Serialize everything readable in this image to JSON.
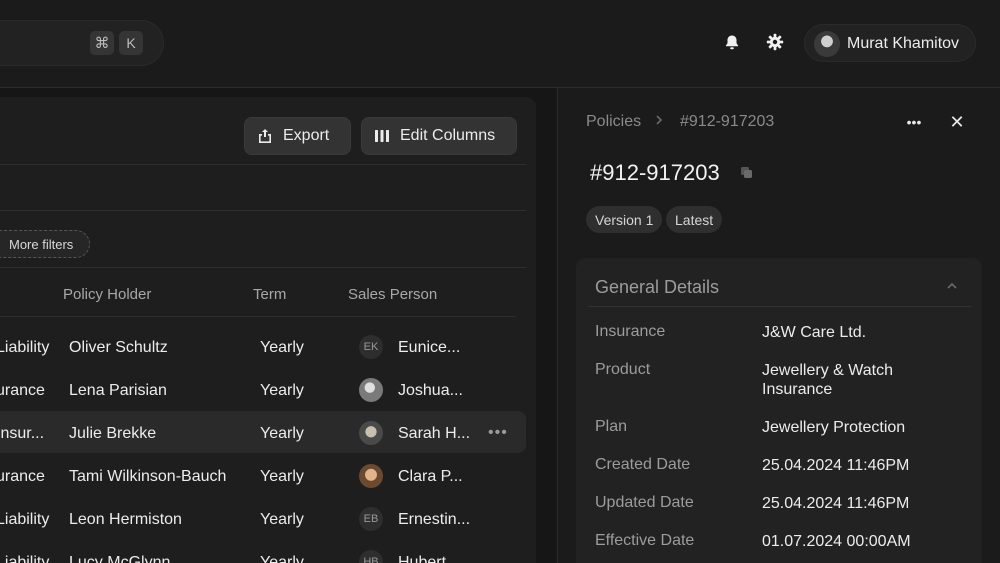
{
  "topbar": {
    "shortcut_keys": [
      "⌘",
      "K"
    ],
    "notification_icon": "bell-icon",
    "settings_icon": "gear-icon",
    "user_name": "Murat Khamitov"
  },
  "toolbar": {
    "export_label": "Export",
    "edit_columns_label": "Edit Columns"
  },
  "filters": {
    "more_filters_label": "More filters"
  },
  "table": {
    "headers": [
      "Policy Holder",
      "Term",
      "Sales Person"
    ],
    "rows": [
      {
        "product": "Liability",
        "holder": "Oliver Schultz",
        "term": "Yearly",
        "avatar": "EK",
        "sales": "Eunice..."
      },
      {
        "product": "urance",
        "holder": "Lena Parisian",
        "term": "Yearly",
        "avatar": "",
        "sales": "Joshua..."
      },
      {
        "product": "Insur...",
        "holder": "Julie Brekke",
        "term": "Yearly",
        "avatar": "",
        "sales": "Sarah H..."
      },
      {
        "product": "urance",
        "holder": "Tami Wilkinson-Bauch",
        "term": "Yearly",
        "avatar": "",
        "sales": "Clara P..."
      },
      {
        "product": "Liability",
        "holder": "Leon Hermiston",
        "term": "Yearly",
        "avatar": "EB",
        "sales": "Ernestin..."
      },
      {
        "product": "Liability",
        "holder": "Lucy McGlynn",
        "term": "Yearly",
        "avatar": "HB",
        "sales": "Hubert..."
      }
    ],
    "row_more_label": "•••"
  },
  "detail": {
    "breadcrumb_root": "Policies",
    "breadcrumb_current": "#912-917203",
    "more_label": "•••",
    "close_label": "✕",
    "title": "#912-917203",
    "badges": [
      "Version 1",
      "Latest"
    ],
    "section_title": "General Details",
    "fields": [
      {
        "label": "Insurance",
        "value": "J&W Care Ltd."
      },
      {
        "label": "Product",
        "value": "Jewellery & Watch Insurance"
      },
      {
        "label": "Plan",
        "value": "Jewellery Protection"
      },
      {
        "label": "Created Date",
        "value": "25.04.2024 11:46PM"
      },
      {
        "label": "Updated Date",
        "value": "25.04.2024 11:46PM"
      },
      {
        "label": "Effective Date",
        "value": "01.07.2024 00:00AM"
      }
    ]
  },
  "colors": {
    "background": "#161616",
    "panel": "#1e1e1e",
    "row_highlight": "#2a2a2a",
    "text": "#ececec",
    "muted_text": "#9c9c9c"
  }
}
